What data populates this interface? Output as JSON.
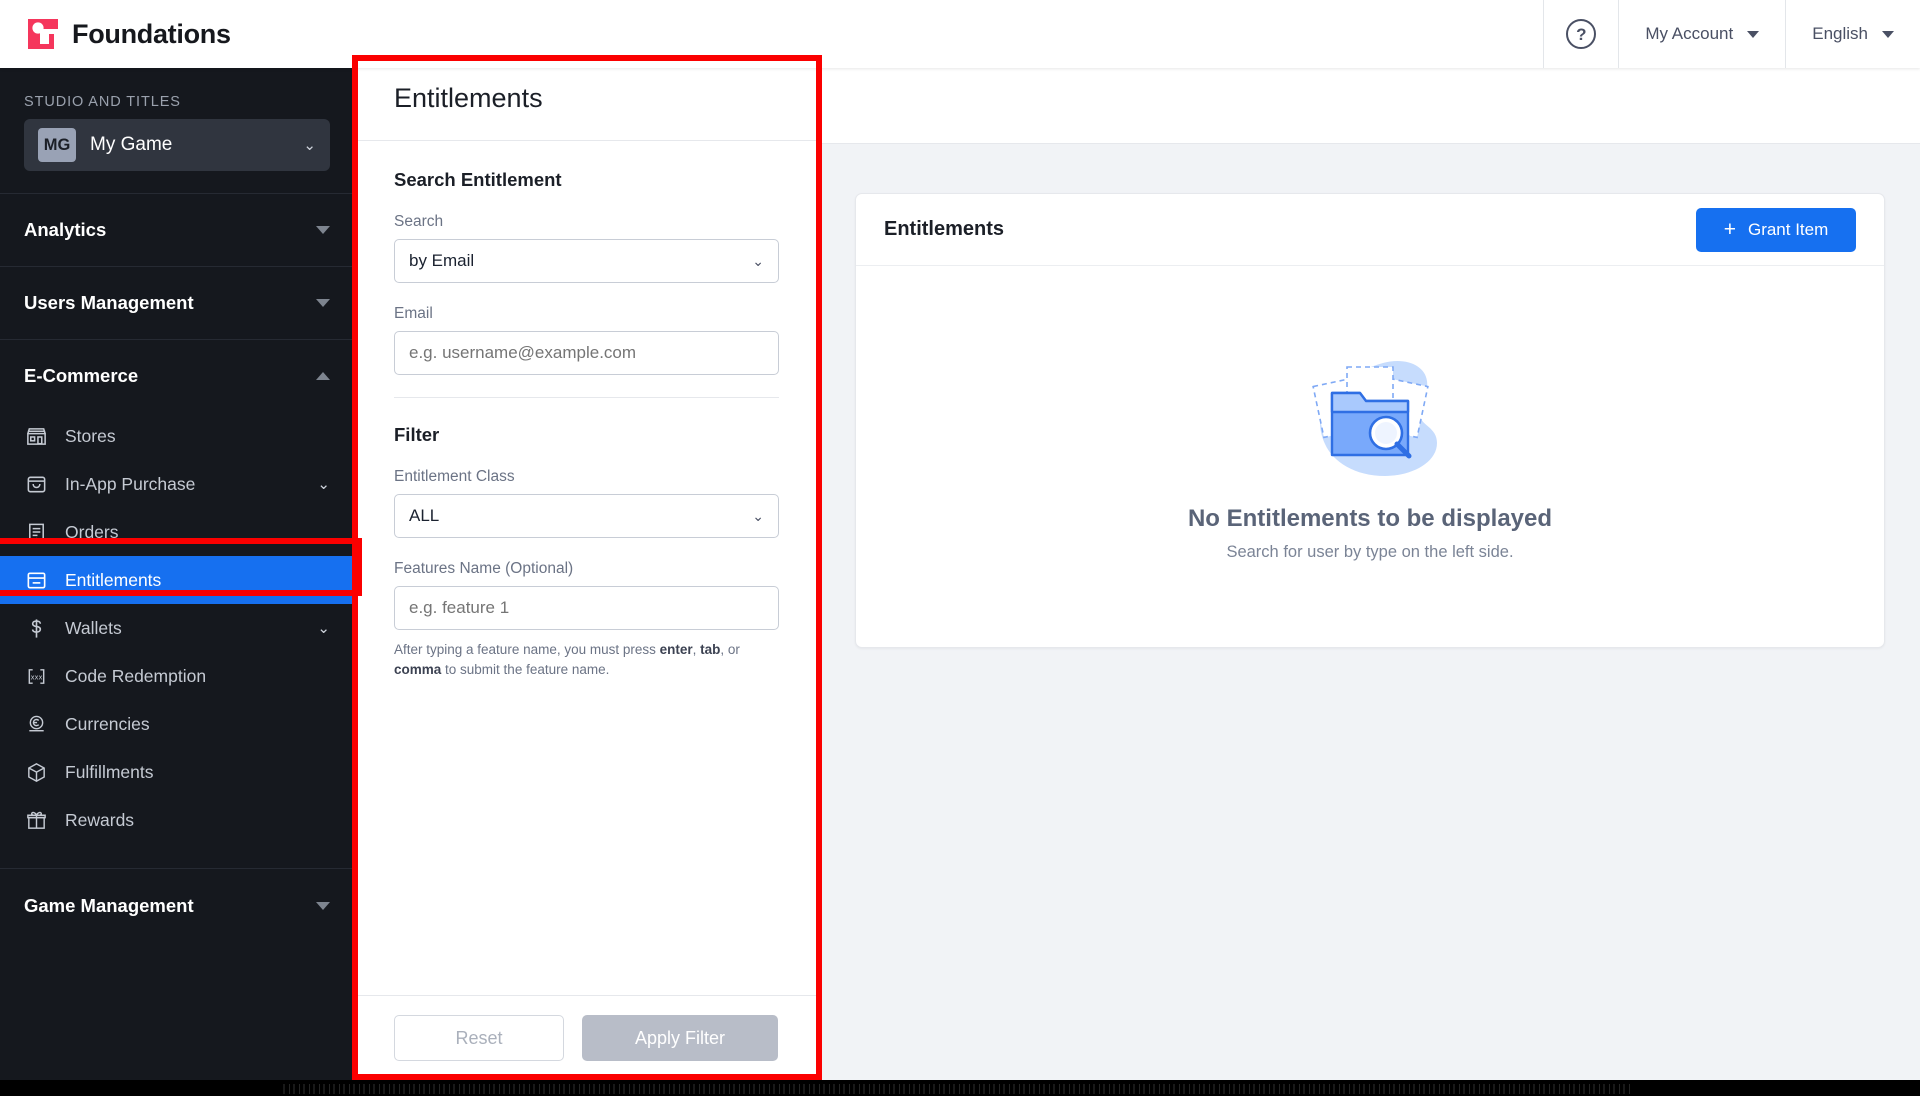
{
  "header": {
    "brand": "Foundations",
    "help_icon": "question-circle-icon",
    "account_label": "My Account",
    "language_label": "English"
  },
  "sidebar": {
    "section_label": "STUDIO AND TITLES",
    "studio": {
      "initials": "MG",
      "name": "My Game"
    },
    "groups": [
      {
        "label": "Analytics",
        "expanded": false
      },
      {
        "label": "Users Management",
        "expanded": false
      },
      {
        "label": "E-Commerce",
        "expanded": true
      },
      {
        "label": "Game Management",
        "expanded": false
      }
    ],
    "ecommerce_items": [
      {
        "label": "Stores",
        "icon": "store-icon",
        "has_chevron": false,
        "active": false
      },
      {
        "label": "In-App Purchase",
        "icon": "bag-icon",
        "has_chevron": true,
        "active": false
      },
      {
        "label": "Orders",
        "icon": "receipt-icon",
        "has_chevron": false,
        "active": false
      },
      {
        "label": "Entitlements",
        "icon": "entitlement-card-icon",
        "has_chevron": false,
        "active": true
      },
      {
        "label": "Wallets",
        "icon": "dollar-icon",
        "has_chevron": true,
        "active": false
      },
      {
        "label": "Code Redemption",
        "icon": "code-brackets-icon",
        "has_chevron": false,
        "active": false
      },
      {
        "label": "Currencies",
        "icon": "coin-icon",
        "has_chevron": false,
        "active": false
      },
      {
        "label": "Fulfillments",
        "icon": "box-icon",
        "has_chevron": false,
        "active": false
      },
      {
        "label": "Rewards",
        "icon": "gift-icon",
        "has_chevron": false,
        "active": false
      }
    ]
  },
  "filter_panel": {
    "title": "Entitlements",
    "search_section_title": "Search Entitlement",
    "search_label": "Search",
    "search_value": "by Email",
    "email_label": "Email",
    "email_placeholder": "e.g. username@example.com",
    "email_value": "",
    "filter_section_title": "Filter",
    "entitlement_class_label": "Entitlement Class",
    "entitlement_class_value": "ALL",
    "features_label": "Features Name (Optional)",
    "features_placeholder": "e.g. feature 1",
    "features_value": "",
    "hint_part1": "After typing a feature name, you must press ",
    "hint_enter": "enter",
    "hint_comma1": ", ",
    "hint_tab": "tab",
    "hint_or": ", or ",
    "hint_comma_word": "comma",
    "hint_part2": " to submit the feature name.",
    "reset_label": "Reset",
    "apply_label": "Apply Filter"
  },
  "main": {
    "card_title": "Entitlements",
    "grant_button_label": "Grant Item",
    "grant_button_icon": "plus-icon",
    "empty_illustration": "folder-search-illustration",
    "empty_title": "No Entitlements to be displayed",
    "empty_subtitle": "Search for user by type on the left side."
  },
  "colors": {
    "brand_red": "#f5365c",
    "accent_blue": "#1670f0",
    "sidebar_bg": "#15181e",
    "annotation_red": "#fb0000"
  }
}
